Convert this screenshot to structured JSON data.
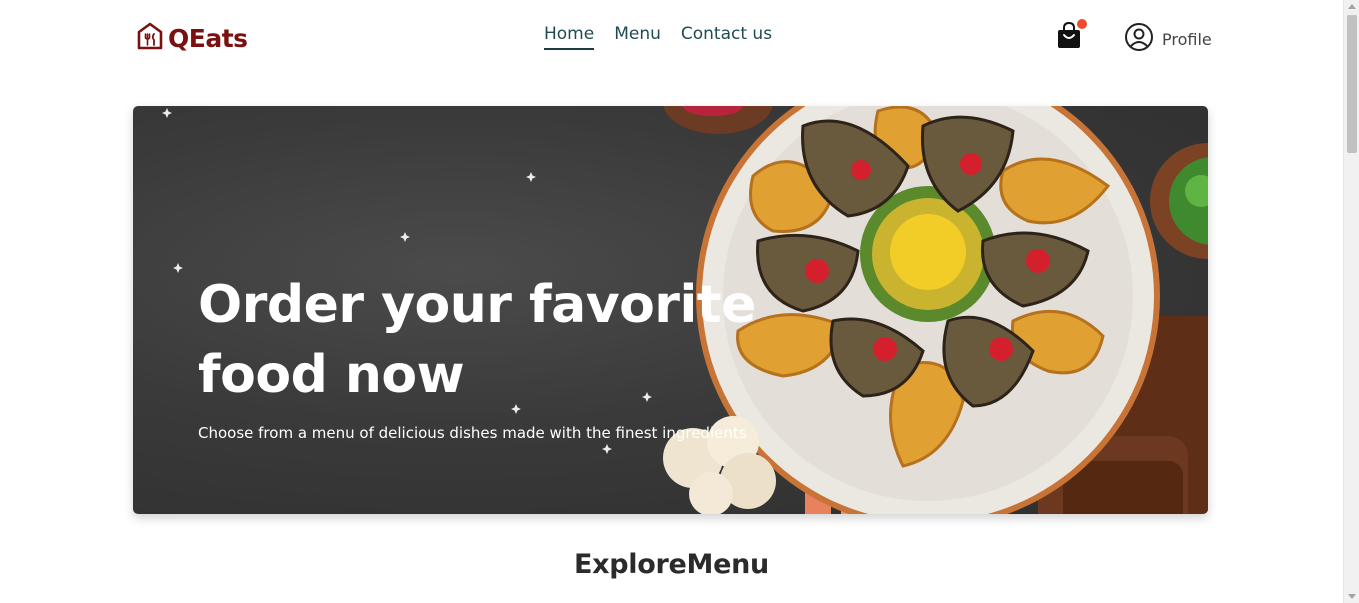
{
  "header": {
    "logo_text": "QEats",
    "logo_icon": "restaurant-house-icon",
    "nav": [
      {
        "label": "Home",
        "active": true
      },
      {
        "label": "Menu",
        "active": false
      },
      {
        "label": "Contact us",
        "active": false
      }
    ],
    "cart_icon": "shopping-bag-icon",
    "profile_icon": "user-circle-icon",
    "profile_label": "Profile"
  },
  "hero": {
    "title": "Order your favorite food now",
    "subtitle": "Choose from a menu of delicious dishes made with the finest ingredients"
  },
  "section": {
    "title": "ExploreMenu"
  },
  "colors": {
    "brand": "#7a1010",
    "nav_text": "#1f4a52",
    "cart_badge": "#ef4a2f",
    "hero_bg": "#3a3a3a"
  }
}
